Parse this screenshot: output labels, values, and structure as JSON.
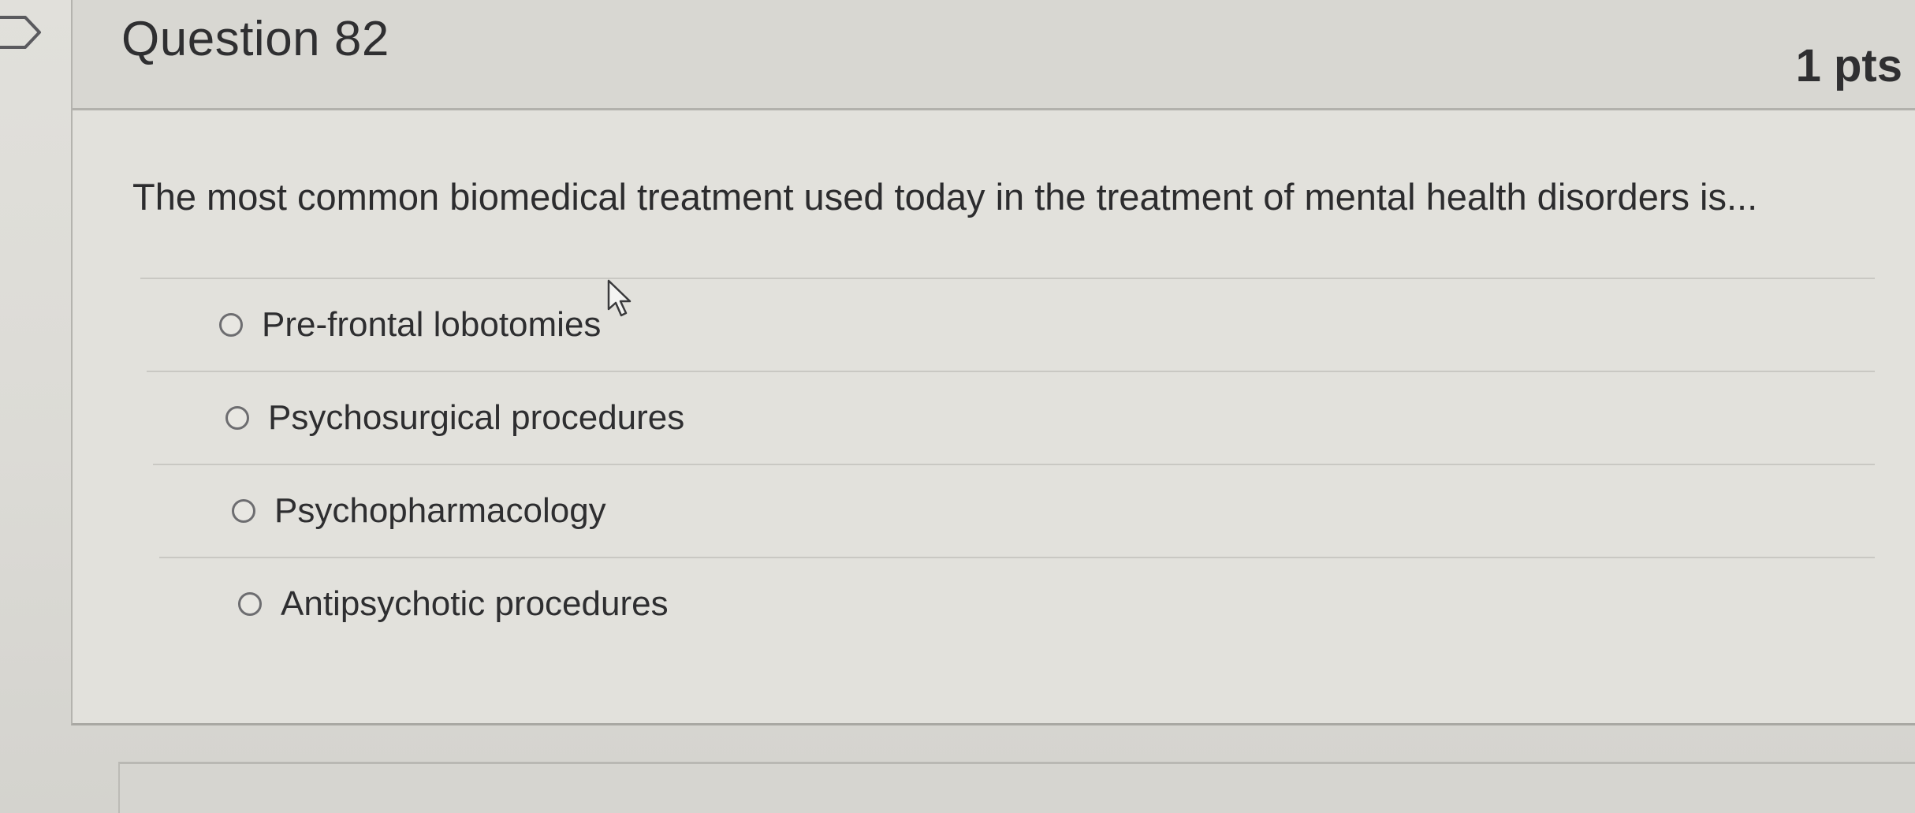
{
  "question": {
    "title": "Question 82",
    "points": "1 pts",
    "text": "The most common biomedical treatment used today in the treatment of mental health disorders is..."
  },
  "answers": [
    {
      "label": "Pre-frontal lobotomies",
      "selected": false
    },
    {
      "label": "Psychosurgical procedures",
      "selected": false
    },
    {
      "label": "Psychopharmacology",
      "selected": false
    },
    {
      "label": "Antipsychotic procedures",
      "selected": false
    }
  ],
  "icons": {
    "flag": "flag-icon",
    "cursor": "mouse-pointer-icon"
  },
  "colors": {
    "text": "#2f2f31",
    "background": "#dcdbd6",
    "header": "#d8d7d2",
    "border": "#b2b1ac"
  }
}
